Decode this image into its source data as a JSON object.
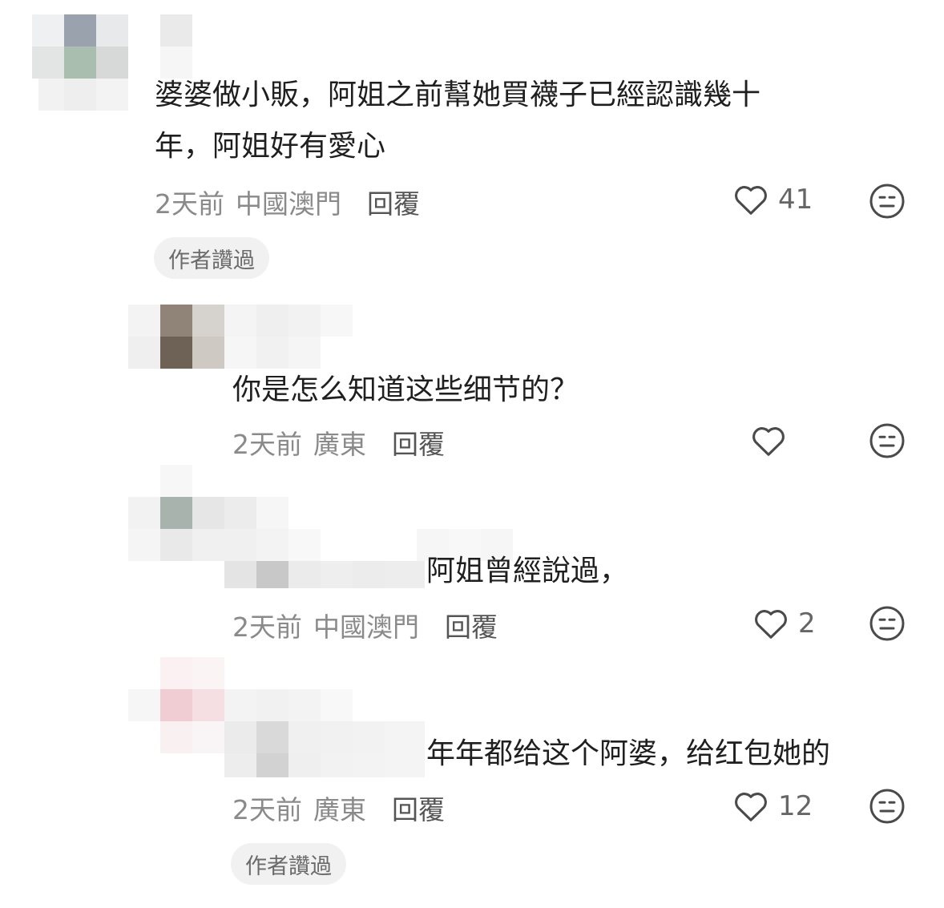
{
  "comments": [
    {
      "text_line1": "婆婆做小販，阿姐之前幫她買襪子已經認識幾十",
      "text_line2": "年，阿姐好有愛心",
      "time": "2天前",
      "location": "中國澳門",
      "reply": "回覆",
      "likes": "41",
      "badge": "作者讚過"
    },
    {
      "text": "你是怎么知道这些细节的？",
      "time": "2天前",
      "location": "廣東",
      "reply": "回覆",
      "likes": ""
    },
    {
      "text": "阿姐曾經說過，",
      "time": "2天前",
      "location": "中國澳門",
      "reply": "回覆",
      "likes": "2"
    },
    {
      "text": "年年都给这个阿婆，给红包她的",
      "time": "2天前",
      "location": "廣東",
      "reply": "回覆",
      "likes": "12",
      "badge": "作者讚過"
    }
  ],
  "icons": {
    "like": "heart-outline-icon",
    "dislike": "neutral-face-icon"
  },
  "colors": {
    "text": "#1f1f1f",
    "meta": "#8a8a8a",
    "badge_bg": "#f1f1f2"
  }
}
